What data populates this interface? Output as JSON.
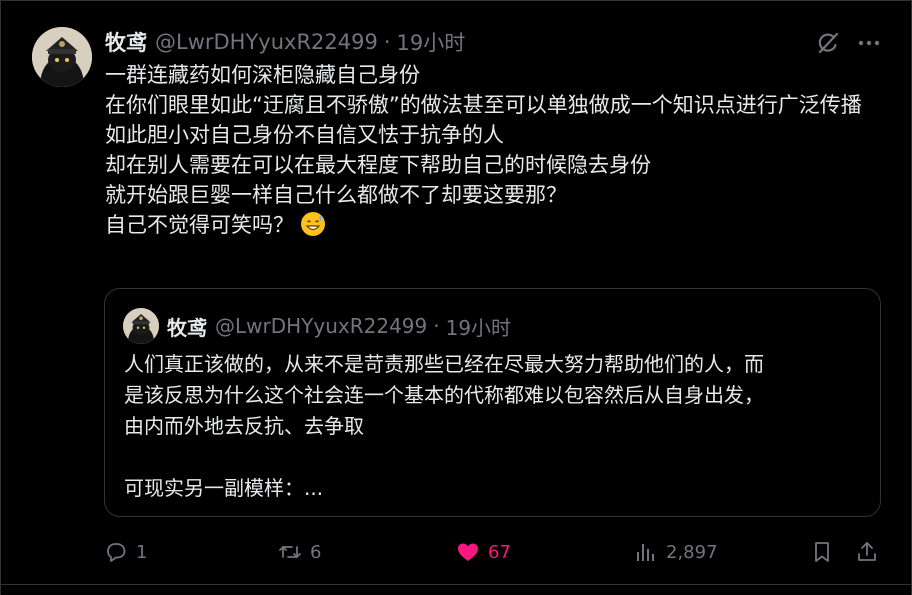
{
  "tweet": {
    "author_name": "牧鸢",
    "author_handle": "@LwrDHYyuxR22499",
    "separator": "·",
    "time": "19小时",
    "lines": [
      "一群连藏药如何深柜隐藏自己身份",
      "在你们眼里如此“迂腐且不骄傲”的做法甚至可以单独做成一个知识点进行广泛传播",
      "如此胆小对自己身份不自信又怯于抗争的人",
      "却在别人需要在可以在最大程度下帮助自己的时候隐去身份",
      "就开始跟巨婴一样自己什么都做不了却要这要那？",
      "自己不觉得可笑吗？"
    ],
    "emoji": "grinning-face-with-sweat-emoji"
  },
  "quote": {
    "author_name": "牧鸢",
    "author_handle": "@LwrDHYyuxR22499",
    "separator": "·",
    "time": "19小时",
    "lines": [
      "人们真正该做的，从来不是苛责那些已经在尽最大努力帮助他们的人，而",
      "是该反思为什么这个社会连一个基本的代称都难以包容然后从自身出发，",
      "由内而外地去反抗、去争取",
      "可现实另一副模样：..."
    ]
  },
  "actions": {
    "reply_count": "1",
    "retweet_count": "6",
    "like_count": "67",
    "view_count": "2,897"
  },
  "icons": {
    "grok": "grok-icon",
    "more": "more-icon",
    "reply": "reply-icon",
    "retweet": "retweet-icon",
    "like": "heart-icon",
    "views": "views-icon",
    "bookmark": "bookmark-icon",
    "share": "share-icon"
  },
  "colors": {
    "background": "#000000",
    "text": "#e7e9ea",
    "secondary": "#71767b",
    "border": "#2f3336",
    "like": "#f91880"
  }
}
